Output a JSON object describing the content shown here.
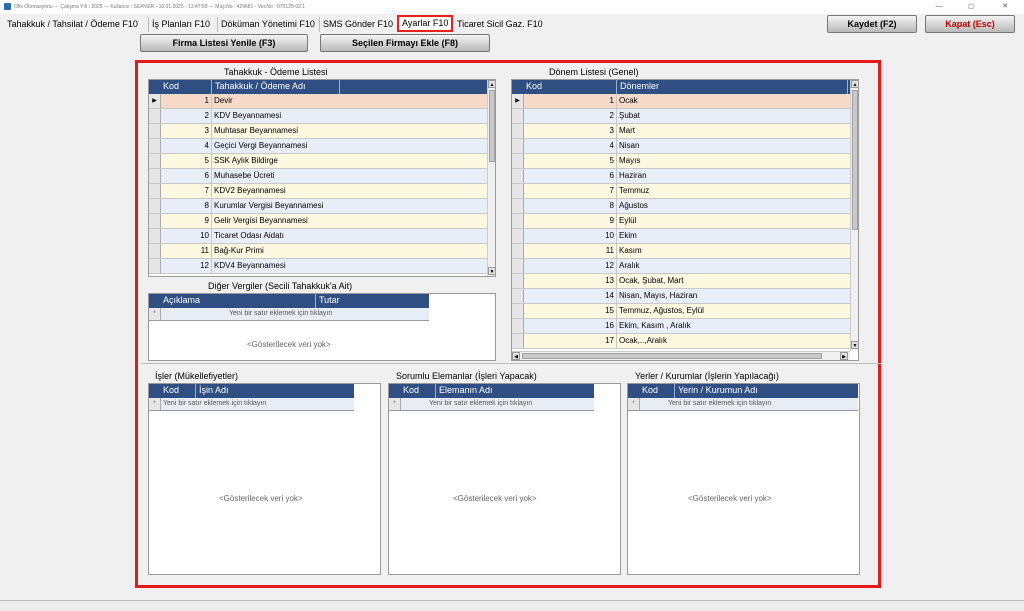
{
  "window": {
    "title": "Ofis Otomasyonu  ---  Çalışma Yılı : 2025  ---  Kullanıcı : SERVER - 16.01.2025 - 13:47:59  ---  Müş.No : 424681  - Ver.No : 070125-02.1",
    "minimize": "—",
    "maximize": "◻",
    "close": "✕"
  },
  "tabs": [
    {
      "label": "Tahakkuk / Tahsilat / Ödeme F10"
    },
    {
      "label": "İş Planları F10"
    },
    {
      "label": "Döküman Yönetimi F10"
    },
    {
      "label": "SMS Gönder F10"
    },
    {
      "label": "Ayarlar F10",
      "active": true
    },
    {
      "label": "Ticaret Sicil Gaz. F10"
    }
  ],
  "buttons": {
    "save": "Kaydet (F2)",
    "close": "Kapat (Esc)",
    "refresh": "Firma Listesi Yenile (F3)",
    "add_selected": "Seçilen Firmayı Ekle (F8)"
  },
  "accent_color": "#e31b1b",
  "header_color": "#2f4f82",
  "tahakkuk": {
    "title": "Tahakkuk - Ödeme Listesi",
    "col_kod": "Kod",
    "col_ad": "Tahakkuk / Ödeme Adı",
    "rows": [
      {
        "kod": "1",
        "ad": "Devir"
      },
      {
        "kod": "2",
        "ad": "KDV Beyannamesi"
      },
      {
        "kod": "3",
        "ad": "Muhtasar Beyannamesi"
      },
      {
        "kod": "4",
        "ad": "Geçici Vergi Beyannamesi"
      },
      {
        "kod": "5",
        "ad": "SSK Aylık Bildirge"
      },
      {
        "kod": "6",
        "ad": "Muhasebe Ücreti"
      },
      {
        "kod": "7",
        "ad": "KDV2 Beyannamesi"
      },
      {
        "kod": "8",
        "ad": "Kurumlar Vergisi Beyannamesi"
      },
      {
        "kod": "9",
        "ad": "Gelir Vergisi Beyannamesi"
      },
      {
        "kod": "10",
        "ad": "Ticaret Odası Aidatı"
      },
      {
        "kod": "11",
        "ad": "Bağ-Kur Primi"
      },
      {
        "kod": "12",
        "ad": "KDV4 Beyannamesi"
      }
    ]
  },
  "diger": {
    "title": "Diğer Vergiler (Secili Tahakkuk'a Ait)",
    "col_aciklama": "Açıklama",
    "col_tutar": "Tutar",
    "new_row": "Yeni bir satır eklemek için tıklayın",
    "empty": "<Gösterilecek veri yok>"
  },
  "donem": {
    "title": "Dönem Listesi (Genel)",
    "col_kod": "Kod",
    "col_ad": "Dönemler",
    "rows": [
      {
        "kod": "1",
        "ad": "Ocak"
      },
      {
        "kod": "2",
        "ad": "Şubat"
      },
      {
        "kod": "3",
        "ad": "Mart"
      },
      {
        "kod": "4",
        "ad": "Nisan"
      },
      {
        "kod": "5",
        "ad": "Mayıs"
      },
      {
        "kod": "6",
        "ad": "Haziran"
      },
      {
        "kod": "7",
        "ad": "Temmuz"
      },
      {
        "kod": "8",
        "ad": "Ağustos"
      },
      {
        "kod": "9",
        "ad": "Eylül"
      },
      {
        "kod": "10",
        "ad": "Ekim"
      },
      {
        "kod": "11",
        "ad": "Kasım"
      },
      {
        "kod": "12",
        "ad": "Aralık"
      },
      {
        "kod": "13",
        "ad": "Ocak, Şubat, Mart"
      },
      {
        "kod": "14",
        "ad": "Nisan, Mayıs, Haziran"
      },
      {
        "kod": "15",
        "ad": "Temmuz, Ağustos, Eylül"
      },
      {
        "kod": "16",
        "ad": "Ekim, Kasım , Aralık"
      },
      {
        "kod": "17",
        "ad": "Ocak,..,Aralık"
      }
    ]
  },
  "isler": {
    "title": "İşler (Mükellefiyetler)",
    "col_kod": "Kod",
    "col_ad": "İşin Adı",
    "new_row": "Yeni bir satır eklemek için tıklayın",
    "empty": "<Gösterilecek veri yok>"
  },
  "sorumlu": {
    "title": "Sorumlu Elemanlar (İşleri Yapacak)",
    "col_kod": "Kod",
    "col_ad": "Elemanın Adı",
    "new_row": "Yeni bir satır eklemek için tıklayın",
    "empty": "<Gösterilecek veri yok>"
  },
  "yerler": {
    "title": "Yerler / Kurumlar (İşlerin Yapılacağı)",
    "col_kod": "Kod",
    "col_ad": "Yerin / Kurumun Adı",
    "new_row": "Yeni bir satır eklemek için tıklayın",
    "empty": "<Gösterilecek veri yok>"
  }
}
